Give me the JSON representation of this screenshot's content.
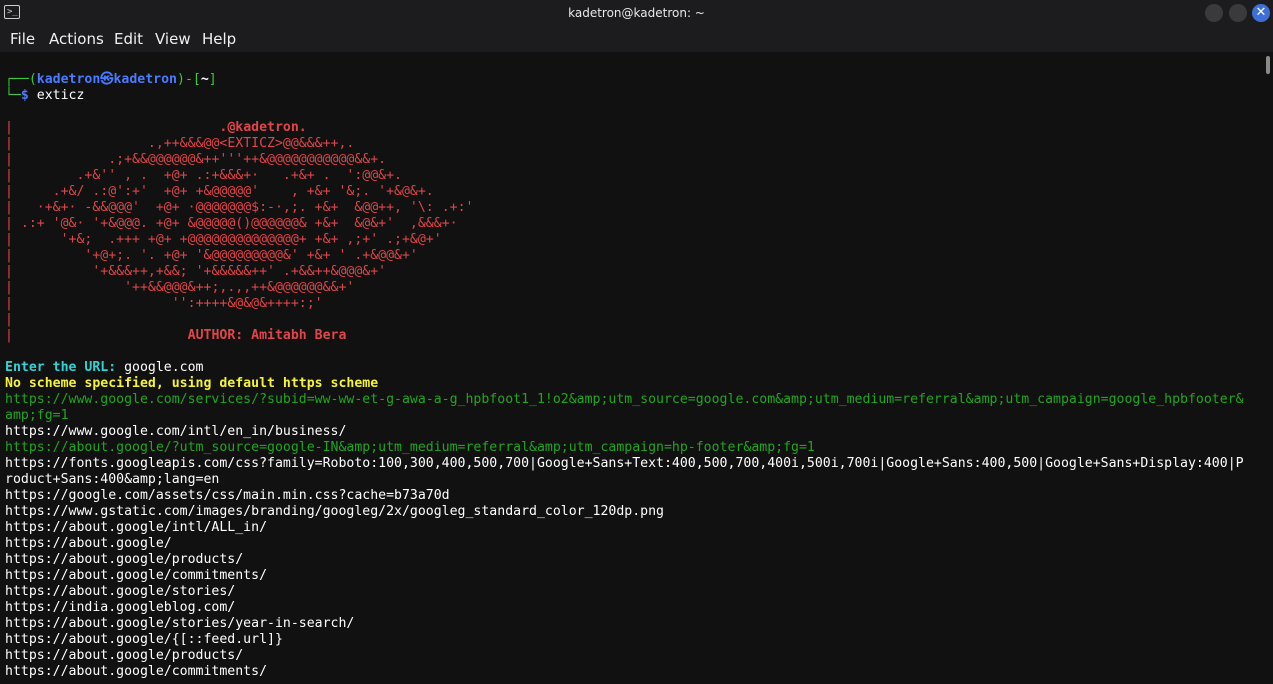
{
  "window": {
    "title": "kadetron@kadetron: ~",
    "icon": "terminal-icon",
    "close_glyph": "✕"
  },
  "menu": [
    "File",
    "Actions",
    "Edit",
    "View",
    "Help"
  ],
  "prompt": {
    "line1_prefix": "┌──(",
    "user": "kadetron",
    "at_glyph": "㉿",
    "host": "kadetron",
    "line1_mid": ")-[",
    "dir": "~",
    "line1_end": "]",
    "line2_prefix": "└─",
    "dollar": "$",
    "command": " exticz"
  },
  "banner": {
    "lines": [
      "                          .@kadetron.",
      "                 .,++&&&@@<EXTICZ>@@&&&++,.",
      "            .;+&&@@@@@@&++'''++&@@@@@@@@@@@&&+.",
      "        .+&'' , .  +@+ .:+&&&+·   .+&+ .  ':@@&+.",
      "     .+&/ .:@':+'  +@+ +&@@@@@'    , +&+ '&;. '+&@&+.",
      "   ·+&+· -&&@@@'  +@+ ·@@@@@@@$:-·,;. +&+  &@@++, '\\: .+:'",
      " .:+ '@&· '+&@@@. +@+ &@@@@@()@@@@@@& +&+  &@&+'  ,&&&+·",
      "      '+&;  .+++ +@+ +@@@@@@@@@@@@@@+ +&+ ,;+' .;+&@+'",
      "         '+@+;. '. +@+ '&@@@@@@@@@&' +&+ ' .+&@@&+'",
      "          '+&&&++,+&&; '+&&&&&++' .+&&++&@@@&+'",
      "              '++&&@@@&++;,.,,++&@@@@@@&&+'",
      "                    '':++++&@&@&++++:;'",
      "",
      "                      AUTHOR: Amitabh Bera"
    ]
  },
  "output": {
    "url_label": "Enter the URL:",
    "url_value": " google.com",
    "scheme_notice": "No scheme specified, using default https scheme",
    "links": [
      {
        "text": "https://www.google.com/services/?subid=ww-ww-et-g-awa-a-g_hpbfoot1_1!o2&amp;utm_source=google.com&amp;utm_medium=referral&amp;utm_campaign=google_hpbfooter&",
        "color": "#1fa61f"
      },
      {
        "text": "amp;fg=1",
        "color": "#1fa61f"
      },
      {
        "text": "https://www.google.com/intl/en_in/business/",
        "color": "#ffffff"
      },
      {
        "text": "https://about.google/?utm_source=google-IN&amp;utm_medium=referral&amp;utm_campaign=hp-footer&amp;fg=1",
        "color": "#1fa61f"
      },
      {
        "text": "https://fonts.googleapis.com/css?family=Roboto:100,300,400,500,700|Google+Sans+Text:400,500,700,400i,500i,700i|Google+Sans:400,500|Google+Sans+Display:400|P",
        "color": "#ffffff"
      },
      {
        "text": "roduct+Sans:400&amp;lang=en",
        "color": "#ffffff"
      },
      {
        "text": "https://google.com/assets/css/main.min.css?cache=b73a70d",
        "color": "#ffffff"
      },
      {
        "text": "https://www.gstatic.com/images/branding/googleg/2x/googleg_standard_color_120dp.png",
        "color": "#ffffff"
      },
      {
        "text": "https://about.google/intl/ALL_in/",
        "color": "#ffffff"
      },
      {
        "text": "https://about.google/",
        "color": "#ffffff"
      },
      {
        "text": "https://about.google/products/",
        "color": "#ffffff"
      },
      {
        "text": "https://about.google/commitments/",
        "color": "#ffffff"
      },
      {
        "text": "https://about.google/stories/",
        "color": "#ffffff"
      },
      {
        "text": "https://india.googleblog.com/",
        "color": "#ffffff"
      },
      {
        "text": "https://about.google/stories/year-in-search/",
        "color": "#ffffff"
      },
      {
        "text": "https://about.google/{[::feed.url]}",
        "color": "#ffffff"
      },
      {
        "text": "https://about.google/products/",
        "color": "#ffffff"
      },
      {
        "text": "https://about.google/commitments/",
        "color": "#ffffff"
      }
    ]
  }
}
